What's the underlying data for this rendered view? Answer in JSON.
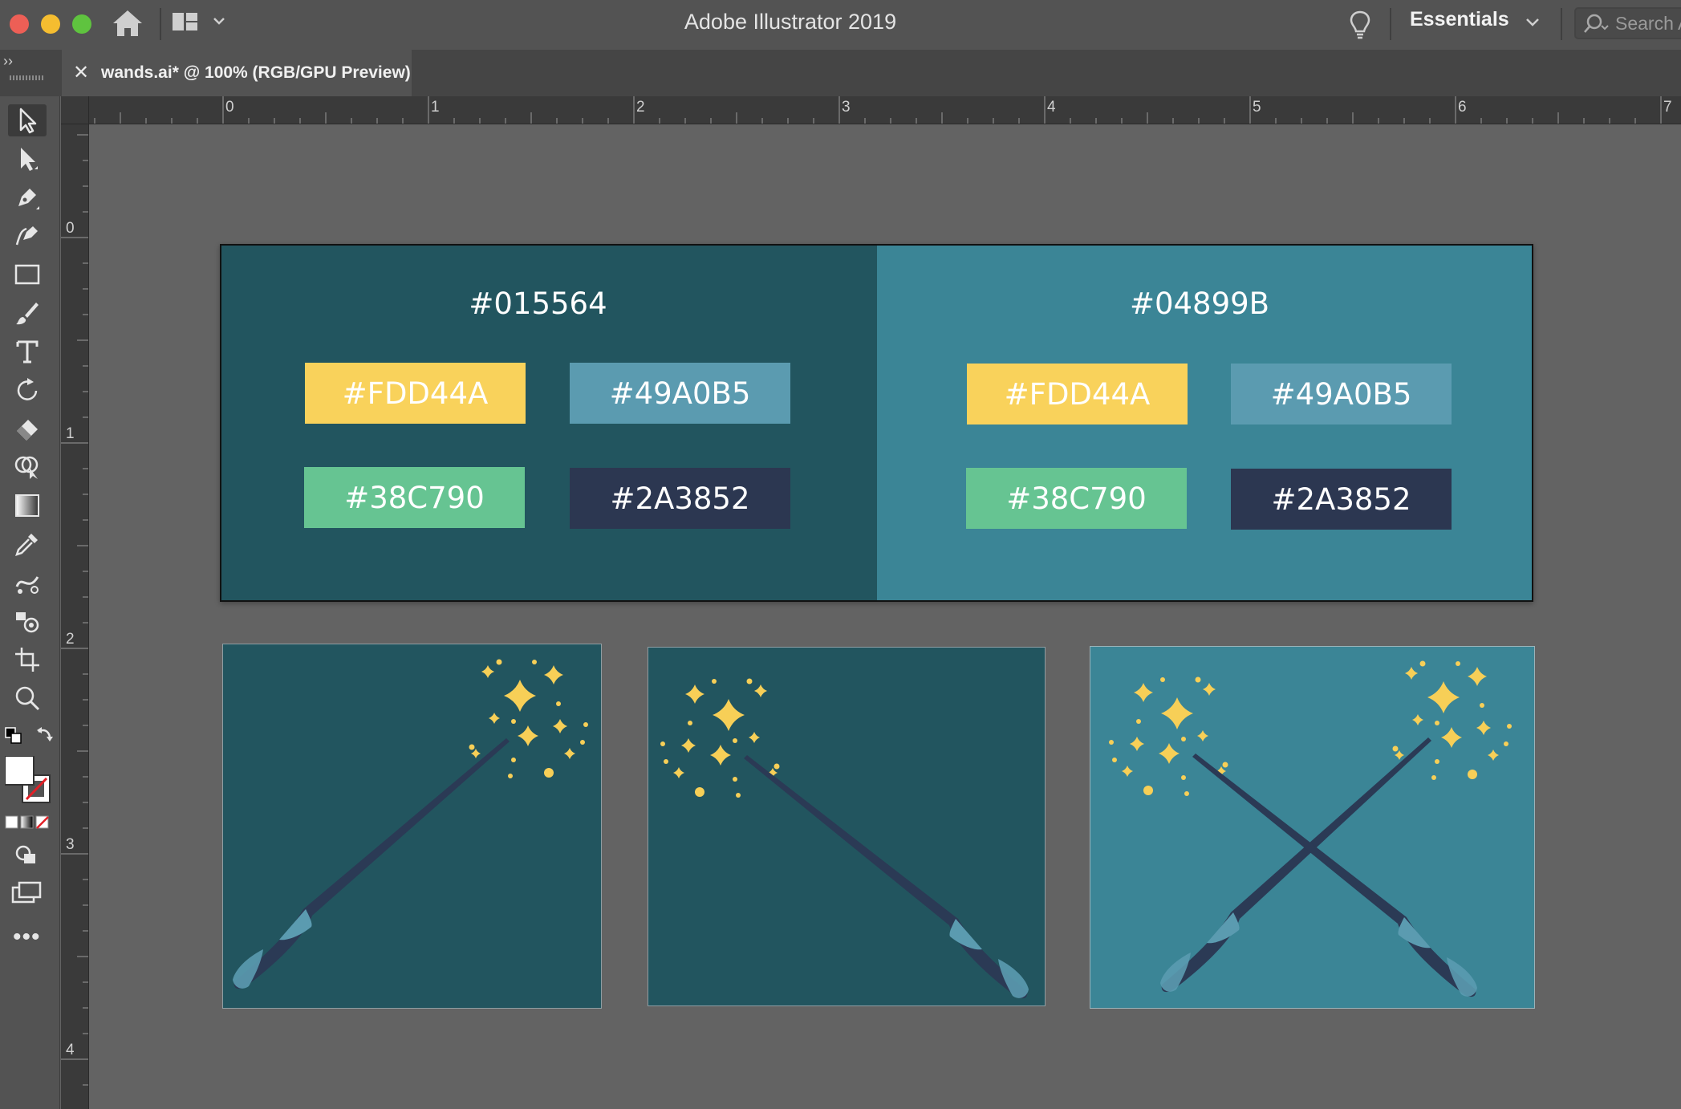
{
  "app": {
    "title": "Adobe Illustrator 2019",
    "workspace": "Essentials",
    "search_placeholder": "Search A"
  },
  "document_tab": {
    "label": "wands.ai* @ 100% (RGB/GPU Preview)"
  },
  "tools": [
    {
      "name": "selection-tool-icon",
      "selected": true
    },
    {
      "name": "direct-selection-tool-icon"
    },
    {
      "name": "pen-tool-icon"
    },
    {
      "name": "curvature-tool-icon"
    },
    {
      "name": "rectangle-tool-icon"
    },
    {
      "name": "paintbrush-tool-icon"
    },
    {
      "name": "type-tool-icon"
    },
    {
      "name": "rotate-tool-icon"
    },
    {
      "name": "eraser-tool-icon"
    },
    {
      "name": "shape-builder-tool-icon"
    },
    {
      "name": "gradient-tool-icon"
    },
    {
      "name": "eyedropper-tool-icon"
    },
    {
      "name": "blend-tool-icon"
    },
    {
      "name": "symbol-sprayer-tool-icon"
    },
    {
      "name": "artboard-tool-icon"
    },
    {
      "name": "zoom-tool-icon"
    }
  ],
  "rulers": {
    "horizontal": [
      "0",
      "1",
      "2",
      "3",
      "4",
      "5",
      "6",
      "7"
    ],
    "vertical": [
      "0",
      "1",
      "2",
      "3",
      "4"
    ]
  },
  "palette": {
    "left": {
      "background": "#22555F",
      "label": "#015564",
      "swatches": [
        {
          "label": "#FDD44A",
          "color": "#F9D25B"
        },
        {
          "label": "#49A0B5",
          "color": "#5B9BB0"
        },
        {
          "label": "#38C790",
          "color": "#66C492"
        },
        {
          "label": "#2A3852",
          "color": "#2C3751"
        }
      ]
    },
    "right": {
      "background": "#3B8596",
      "label": "#04899B",
      "swatches": [
        {
          "label": "#FDD44A",
          "color": "#F9D25B"
        },
        {
          "label": "#49A0B5",
          "color": "#5B9BB0"
        },
        {
          "label": "#38C790",
          "color": "#66C492"
        },
        {
          "label": "#2A3852",
          "color": "#2C3751"
        }
      ]
    }
  },
  "artboards": [
    {
      "name": "wand-right-artboard",
      "background": "#22555F"
    },
    {
      "name": "wand-left-artboard",
      "background": "#22555F"
    },
    {
      "name": "crossed-wands-artboard",
      "background": "#3B8596"
    }
  ],
  "colors": {
    "star": "#F7CF57",
    "wand": "#2B3A55",
    "grip": "#5B9BB0"
  }
}
